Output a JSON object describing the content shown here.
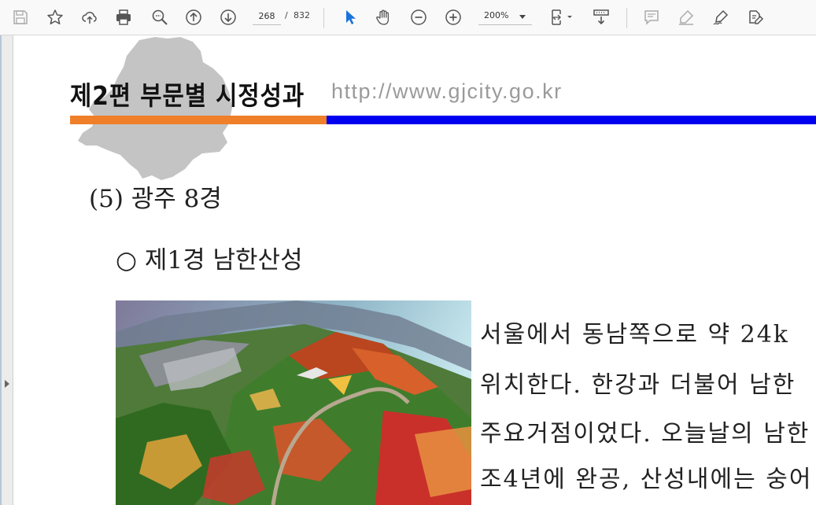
{
  "toolbar": {
    "page_current": "268",
    "page_separator": "/",
    "page_total": "832",
    "zoom": "200%",
    "icons": [
      "save-icon",
      "bookmark-star-icon",
      "upload-icon",
      "print-icon",
      "zoom-search-icon",
      "page-up-icon",
      "page-down-icon",
      "select-cursor-icon",
      "hand-pan-icon",
      "zoom-out-icon",
      "zoom-in-icon",
      "fit-page-icon",
      "scroll-mode-icon",
      "comment-icon",
      "highlight-icon",
      "sign-icon",
      "fill-edit-icon"
    ]
  },
  "document": {
    "chapter_title": "제2편 부문별 시정성과",
    "site_url": "http://www.gjcity.go.kr",
    "section_heading": "(5) 광주 8경",
    "subsection_heading": "○ 제1경 남한산성",
    "body_lines": [
      "  서울에서 동남쪽으로 약 24k",
      "위치한다. 한강과 더불어 남한",
      "주요거점이었다. 오늘날의 남한",
      "조4년에 완공, 산성내에는 숭어"
    ]
  },
  "colors": {
    "accent_orange": "#f07f2a",
    "accent_blue": "#0000f0",
    "toolbar_icon": "#555555",
    "select_active": "#1a73d9"
  }
}
